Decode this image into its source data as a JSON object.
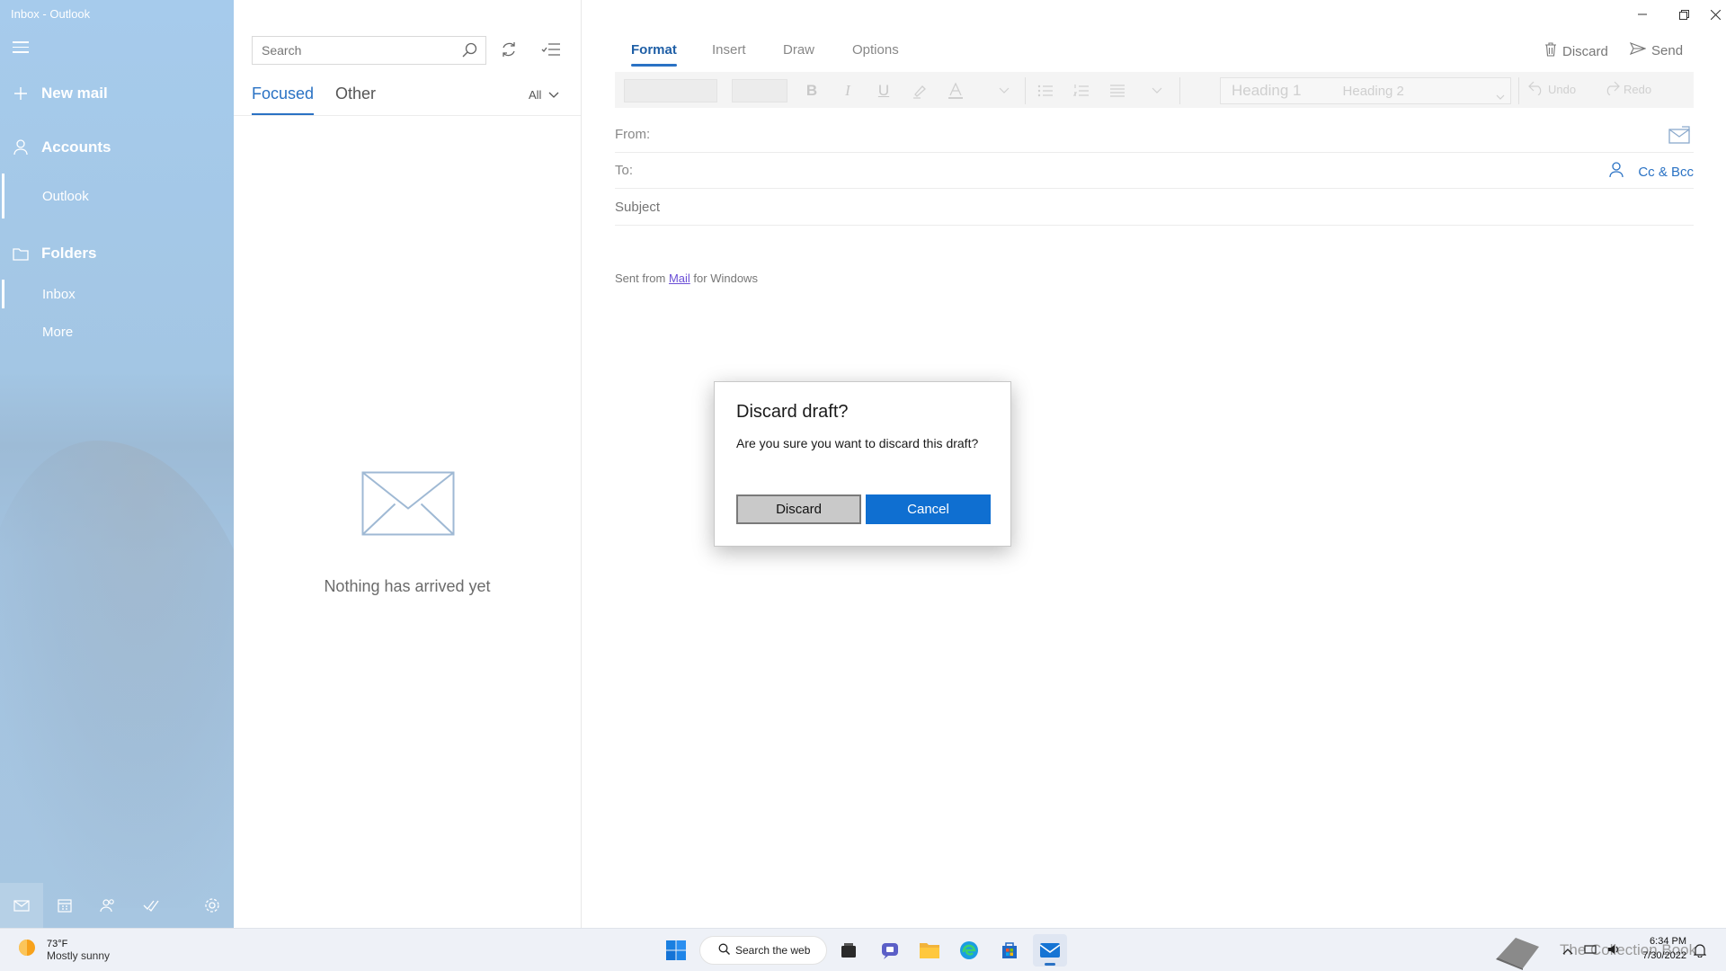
{
  "window": {
    "title": "Inbox - Outlook"
  },
  "nav": {
    "new_mail": "New mail",
    "accounts": "Accounts",
    "account_name": "Outlook",
    "folders": "Folders",
    "folder_inbox": "Inbox",
    "folder_more": "More"
  },
  "list": {
    "search_placeholder": "Search",
    "tab_focused": "Focused",
    "tab_other": "Other",
    "filter": "All",
    "empty_text": "Nothing has arrived yet"
  },
  "compose": {
    "tabs": [
      "Format",
      "Insert",
      "Draw",
      "Options"
    ],
    "discard_label": "Discard",
    "send_label": "Send",
    "style_heading1": "Heading 1",
    "style_heading2": "Heading 2",
    "undo": "Undo",
    "redo": "Redo",
    "from_label": "From:",
    "to_label": "To:",
    "subject_placeholder": "Subject",
    "cc_bcc": "Cc & Bcc",
    "signature_prefix": "Sent from ",
    "signature_link": "Mail",
    "signature_suffix": " for Windows"
  },
  "dialog": {
    "title": "Discard draft?",
    "message": "Are you sure you want to discard this draft?",
    "discard_button": "Discard",
    "cancel_button": "Cancel"
  },
  "taskbar": {
    "weather_temp": "73°F",
    "weather_desc": "Mostly sunny",
    "search_label": "Search the web",
    "tray_overlay_text": "The Collection Book",
    "time": "6:34 PM",
    "date": "7/30/2022"
  },
  "colors": {
    "accent": "#2a72c4",
    "dialog_primary": "#0f6fd1",
    "nav_background": "#a6cbec"
  }
}
